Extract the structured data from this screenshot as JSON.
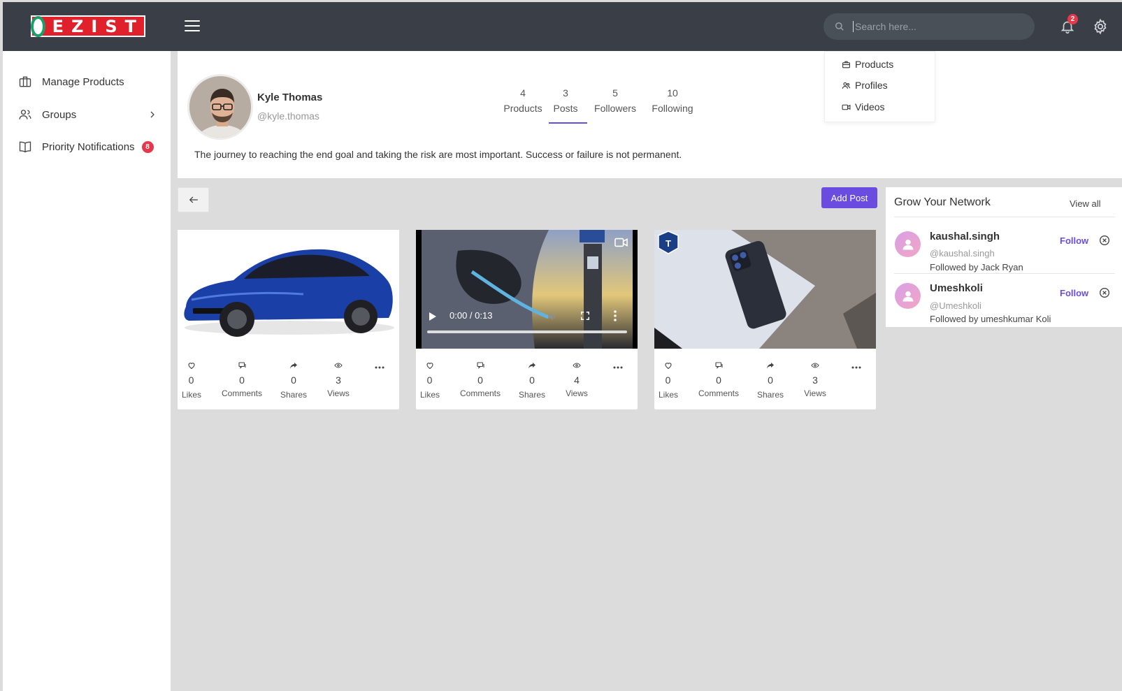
{
  "brand": {
    "logo_text": "EZIST",
    "logo_mark_text": "EZIST"
  },
  "search": {
    "placeholder": "Search here..."
  },
  "notifications": {
    "count": "2"
  },
  "sidebar": {
    "items": [
      {
        "label": "Manage Products"
      },
      {
        "label": "Groups"
      },
      {
        "label": "Priority Notifications",
        "badge": "8"
      }
    ]
  },
  "profile": {
    "name": "Kyle Thomas",
    "handle": "@kyle.thomas",
    "bio": "The journey to reaching the end goal and taking the risk are most important. Success or failure is not permanent.",
    "stats": [
      {
        "value": "4",
        "label": "Products"
      },
      {
        "value": "3",
        "label": "Posts"
      },
      {
        "value": "5",
        "label": "Followers"
      },
      {
        "value": "10",
        "label": "Following"
      }
    ],
    "active_tab": "Posts"
  },
  "search_dropdown": {
    "items": [
      {
        "label": "Products"
      },
      {
        "label": "Profiles"
      },
      {
        "label": "Videos"
      }
    ]
  },
  "actions": {
    "add_post": "Add Post"
  },
  "posts": [
    {
      "type": "image",
      "likes": "0",
      "comments": "0",
      "shares": "0",
      "views": "3"
    },
    {
      "type": "video",
      "video_time": "0:00 / 0:13",
      "likes": "0",
      "comments": "0",
      "shares": "0",
      "views": "4"
    },
    {
      "type": "image",
      "likes": "0",
      "comments": "0",
      "shares": "0",
      "views": "3"
    }
  ],
  "metric_labels": {
    "likes": "Likes",
    "comments": "Comments",
    "shares": "Shares",
    "views": "Views"
  },
  "network": {
    "title": "Grow Your Network",
    "view_all": "View all",
    "people": [
      {
        "name": "kaushal.singh",
        "handle": "@kaushal.singh",
        "followed_by": "Followed by Jack Ryan",
        "action": "Follow"
      },
      {
        "name": "Umeshkoli",
        "handle": "@Umeshkoli",
        "followed_by": "Followed by umeshkumar Koli",
        "action": "Follow"
      }
    ]
  },
  "colors": {
    "accent": "#6a4de0",
    "topbar": "#3a3f47",
    "badge": "#e6374b",
    "brand_red": "#e0202a"
  }
}
